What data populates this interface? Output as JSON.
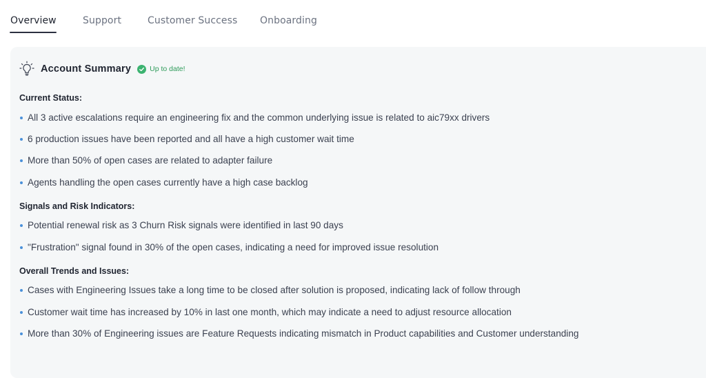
{
  "tabs": [
    {
      "label": "Overview",
      "active": true
    },
    {
      "label": "Support",
      "active": false
    },
    {
      "label": "Customer Success",
      "active": false
    },
    {
      "label": "Onboarding",
      "active": false
    }
  ],
  "summary": {
    "title": "Account Summary",
    "status": "Up to date!",
    "icon": "lightbulb-icon",
    "status_icon": "check-circle-icon",
    "status_color": "#3cb371"
  },
  "sections": [
    {
      "heading": "Current Status:",
      "items": [
        "All 3 active escalations require an engineering fix and the common underlying issue is related to aic79xx drivers",
        "6 production issues have been reported and all have a high customer wait time",
        "More than 50% of open cases are related to adapter failure",
        "Agents handling the open cases currently have a high case backlog"
      ]
    },
    {
      "heading": "Signals and Risk Indicators:",
      "items": [
        "Potential renewal risk as 3 Churn Risk signals were identified in last 90 days",
        "\"Frustration\" signal found in 30% of the open cases, indicating a need for improved issue resolution"
      ]
    },
    {
      "heading": "Overall Trends and Issues:",
      "items": [
        "Cases with Engineering Issues take a long time to be closed after solution is proposed, indicating lack of follow through",
        "Customer wait time has increased by 10% in last one month, which may indicate a need to adjust resource allocation",
        "More than 30% of Engineering issues are Feature Requests indicating mismatch in Product capabilities and Customer understanding"
      ]
    }
  ],
  "colors": {
    "bullet": "#4a90d9",
    "panel_bg": "#f5f7f8",
    "active_tab": "#1f2430",
    "inactive_tab": "#6b7280"
  }
}
